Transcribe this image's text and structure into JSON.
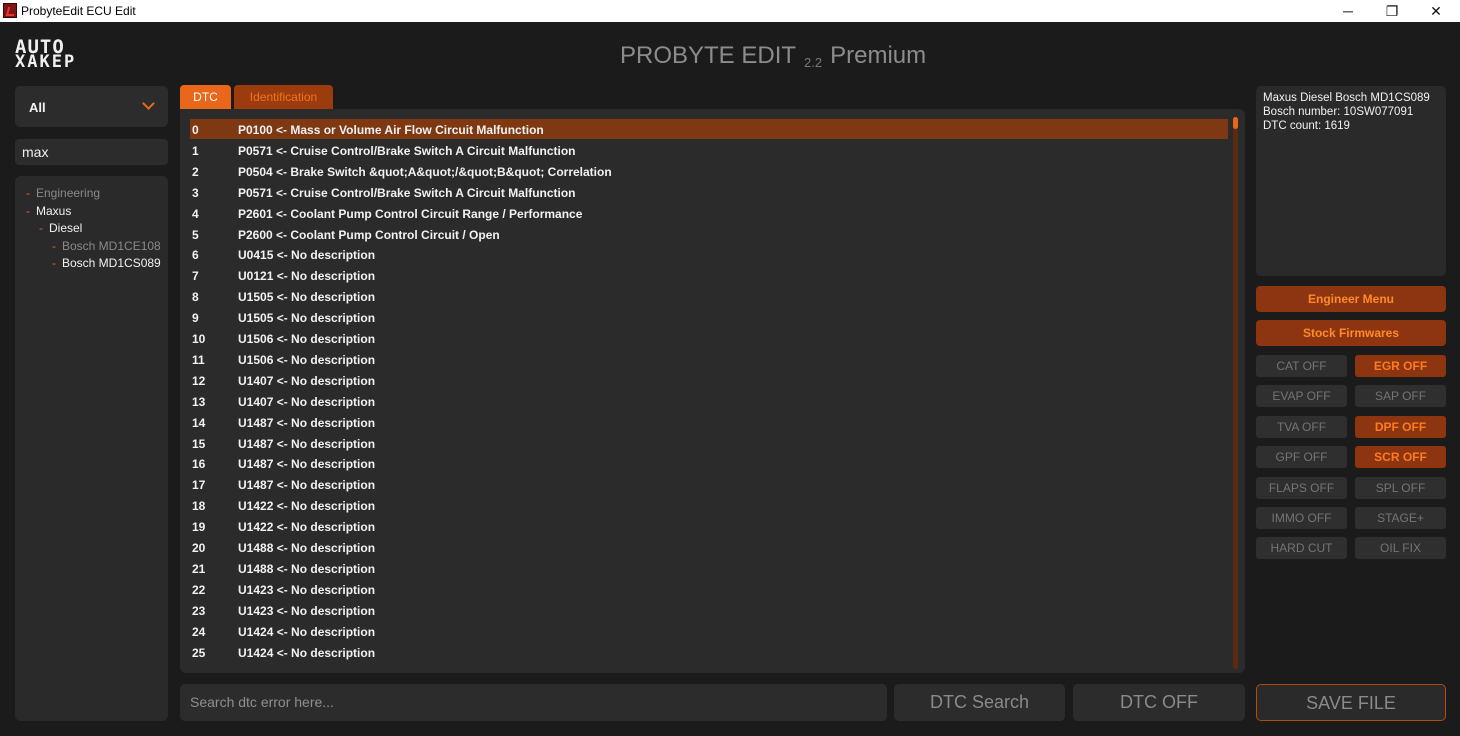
{
  "window": {
    "title": "ProbyteEdit ECU Edit",
    "minimize": "─",
    "maximize": "❐",
    "close": "✕"
  },
  "logo": {
    "line1": "AUTO",
    "line2": "XAKEP"
  },
  "header": {
    "name": "PROBYTE EDIT",
    "version": "2.2",
    "edition": "Premium"
  },
  "sidebar": {
    "filter_value": "All",
    "search_value": "max",
    "tree": [
      {
        "label": "Engineering",
        "level": 0,
        "state": "dim"
      },
      {
        "label": "Maxus",
        "level": 0,
        "state": "bright"
      },
      {
        "label": "Diesel",
        "level": 1,
        "state": "bright"
      },
      {
        "label": "Bosch MD1CE108",
        "level": 2,
        "state": "dim"
      },
      {
        "label": "Bosch MD1CS089",
        "level": 2,
        "state": "bright"
      }
    ]
  },
  "tabs": {
    "dtc": "DTC",
    "identification": "Identification"
  },
  "dtc_list": [
    {
      "index": "0",
      "text": "P0100 <- Mass or Volume Air Flow Circuit Malfunction",
      "selected": true
    },
    {
      "index": "1",
      "text": "P0571 <- Cruise Control/Brake Switch A Circuit Malfunction"
    },
    {
      "index": "2",
      "text": "P0504 <- Brake Switch &quot;A&quot;/&quot;B&quot; Correlation"
    },
    {
      "index": "3",
      "text": "P0571 <- Cruise Control/Brake Switch A Circuit Malfunction"
    },
    {
      "index": "4",
      "text": "P2601 <- Coolant Pump Control Circuit Range / Performance"
    },
    {
      "index": "5",
      "text": "P2600 <- Coolant Pump Control Circuit / Open"
    },
    {
      "index": "6",
      "text": "U0415 <- No description"
    },
    {
      "index": "7",
      "text": "U0121 <- No description"
    },
    {
      "index": "8",
      "text": "U1505 <- No description"
    },
    {
      "index": "9",
      "text": "U1505 <- No description"
    },
    {
      "index": "10",
      "text": "U1506 <- No description"
    },
    {
      "index": "11",
      "text": "U1506 <- No description"
    },
    {
      "index": "12",
      "text": "U1407 <- No description"
    },
    {
      "index": "13",
      "text": "U1407 <- No description"
    },
    {
      "index": "14",
      "text": "U1487 <- No description"
    },
    {
      "index": "15",
      "text": "U1487 <- No description"
    },
    {
      "index": "16",
      "text": "U1487 <- No description"
    },
    {
      "index": "17",
      "text": "U1487 <- No description"
    },
    {
      "index": "18",
      "text": "U1422 <- No description"
    },
    {
      "index": "19",
      "text": "U1422 <- No description"
    },
    {
      "index": "20",
      "text": "U1488 <- No description"
    },
    {
      "index": "21",
      "text": "U1488 <- No description"
    },
    {
      "index": "22",
      "text": "U1423 <- No description"
    },
    {
      "index": "23",
      "text": "U1423 <- No description"
    },
    {
      "index": "24",
      "text": "U1424 <- No description"
    },
    {
      "index": "25",
      "text": "U1424 <- No description"
    }
  ],
  "bottom": {
    "search_placeholder": "Search dtc error here...",
    "dtc_search": "DTC Search",
    "dtc_off": "DTC OFF",
    "save_file": "SAVE FILE"
  },
  "info": {
    "line1": "Maxus Diesel Bosch MD1CS089",
    "line2": "Bosch number: 10SW077091",
    "line3": "DTC count: 1619"
  },
  "menus": {
    "engineer": "Engineer Menu",
    "stock": "Stock Firmwares"
  },
  "options": [
    {
      "label": "CAT OFF",
      "active": false
    },
    {
      "label": "EGR OFF",
      "active": true
    },
    {
      "label": "EVAP OFF",
      "active": false
    },
    {
      "label": "SAP OFF",
      "active": false
    },
    {
      "label": "TVA OFF",
      "active": false
    },
    {
      "label": "DPF OFF",
      "active": true
    },
    {
      "label": "GPF OFF",
      "active": false
    },
    {
      "label": "SCR OFF",
      "active": true
    },
    {
      "label": "FLAPS OFF",
      "active": false
    },
    {
      "label": "SPL OFF",
      "active": false
    },
    {
      "label": "IMMO OFF",
      "active": false
    },
    {
      "label": "STAGE+",
      "active": false
    },
    {
      "label": "HARD CUT",
      "active": false
    },
    {
      "label": "OIL FIX",
      "active": false
    }
  ],
  "colors": {
    "accent": "#e8671a",
    "accent_dark": "#8c3510",
    "background": "#1b1b1b",
    "panel": "#2b2b2b"
  }
}
